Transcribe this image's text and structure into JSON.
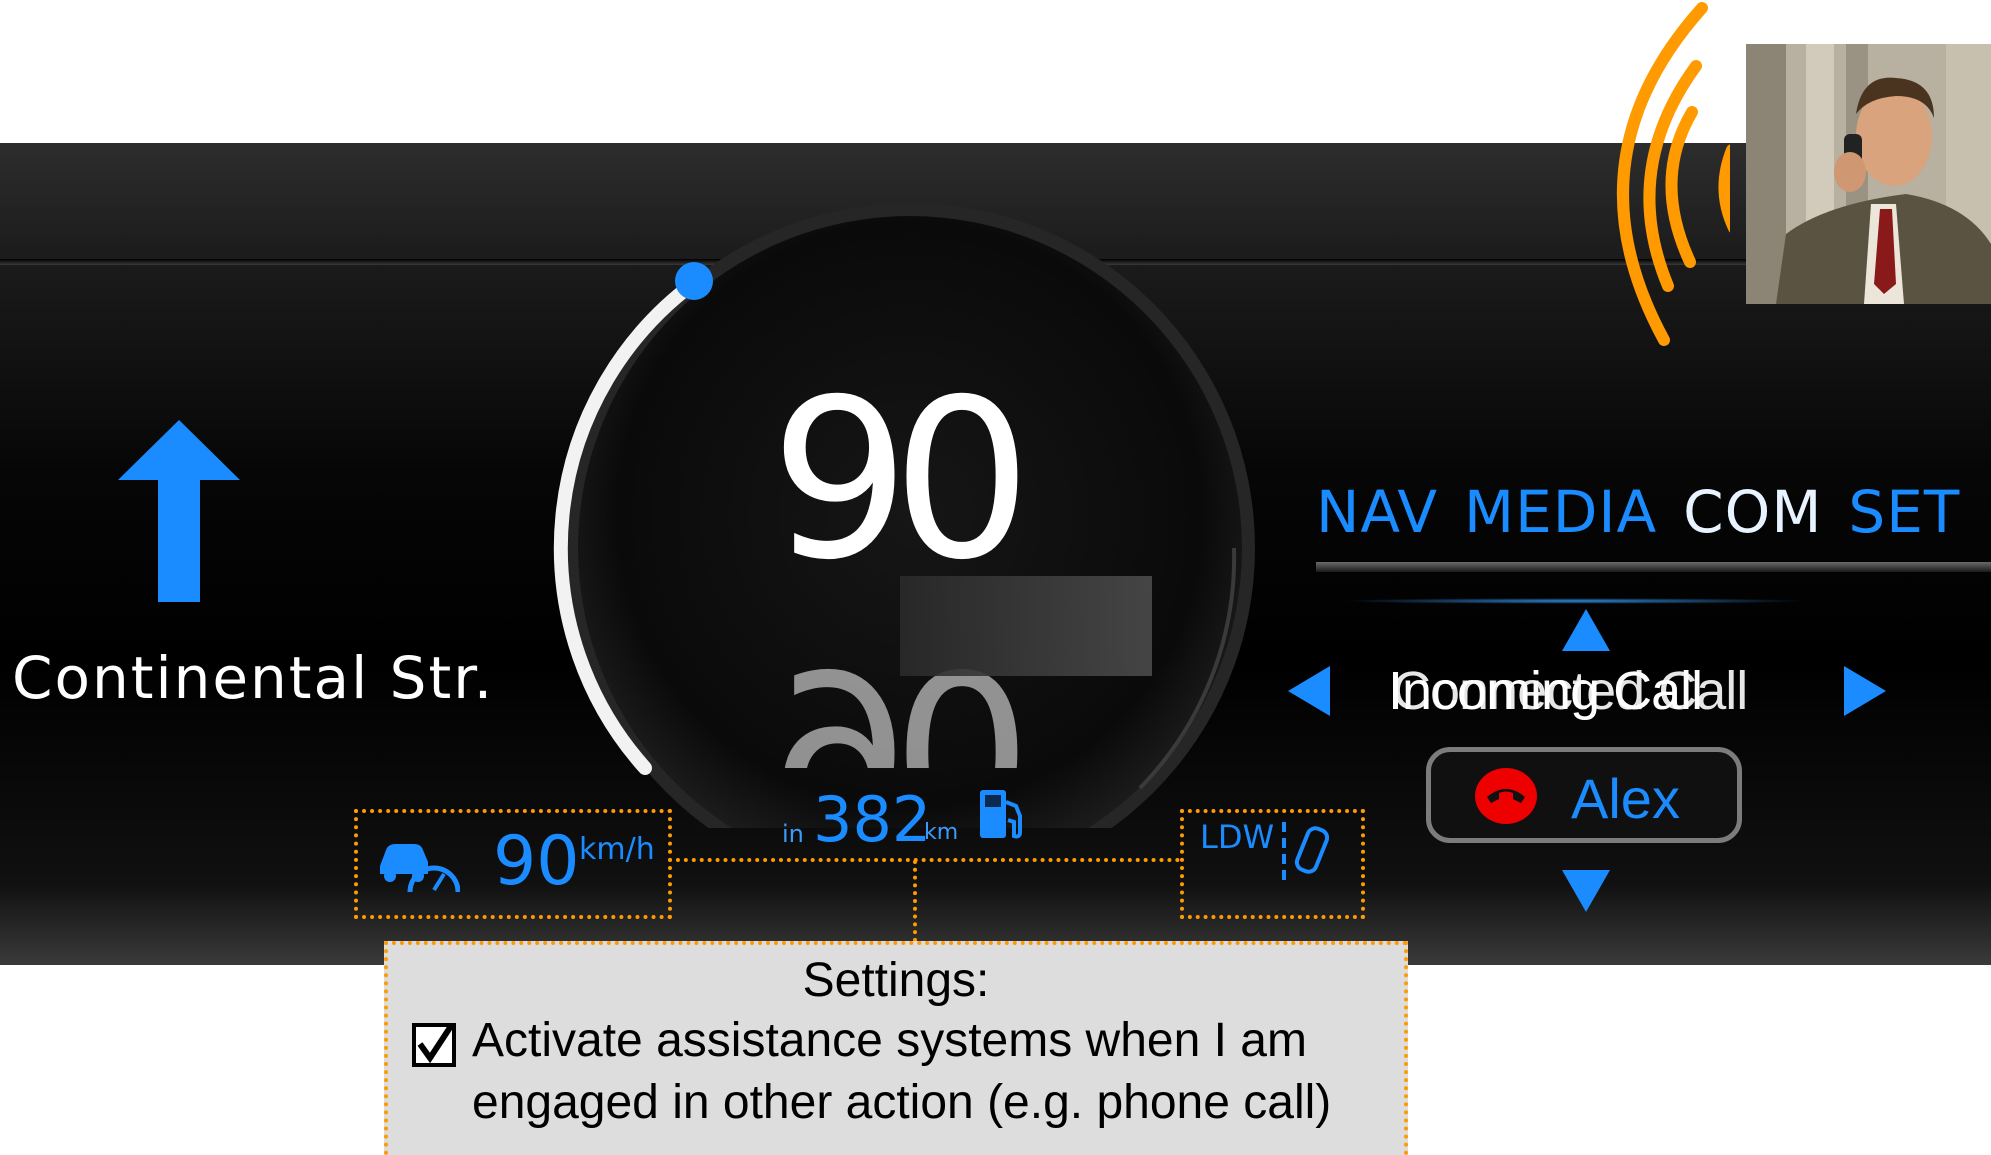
{
  "navigation": {
    "direction_icon": "arrow-up-icon",
    "street": "Continental Str."
  },
  "speedometer": {
    "speed": "90",
    "accent_color": "#1a8cff"
  },
  "cruise_control": {
    "icon": "adaptive-cruise-icon",
    "speed": "90",
    "unit": "km/h"
  },
  "range": {
    "prefix": "in",
    "value": "382",
    "unit": "km",
    "icon": "fuel-pump-icon"
  },
  "lane_departure": {
    "label": "LDW",
    "icon": "lane-departure-icon"
  },
  "menu": {
    "tabs": [
      {
        "label": "NAV",
        "active": false
      },
      {
        "label": "MEDIA",
        "active": false
      },
      {
        "label": "COM",
        "active": true
      },
      {
        "label": "SET",
        "active": false
      }
    ]
  },
  "call": {
    "title_a": "Incoming Call",
    "title_b": "Connected Call",
    "caller": "Alex",
    "hangup_icon": "hang-up-phone-icon"
  },
  "incoming_call_indicator": {
    "waves_color": "#ff9a00"
  },
  "settings": {
    "title": "Settings:",
    "checked": true,
    "option_line1": "Activate assistance systems when I am",
    "option_line2": "engaged in other action (e.g. phone call)"
  },
  "annotation_color": "#ff9a00"
}
